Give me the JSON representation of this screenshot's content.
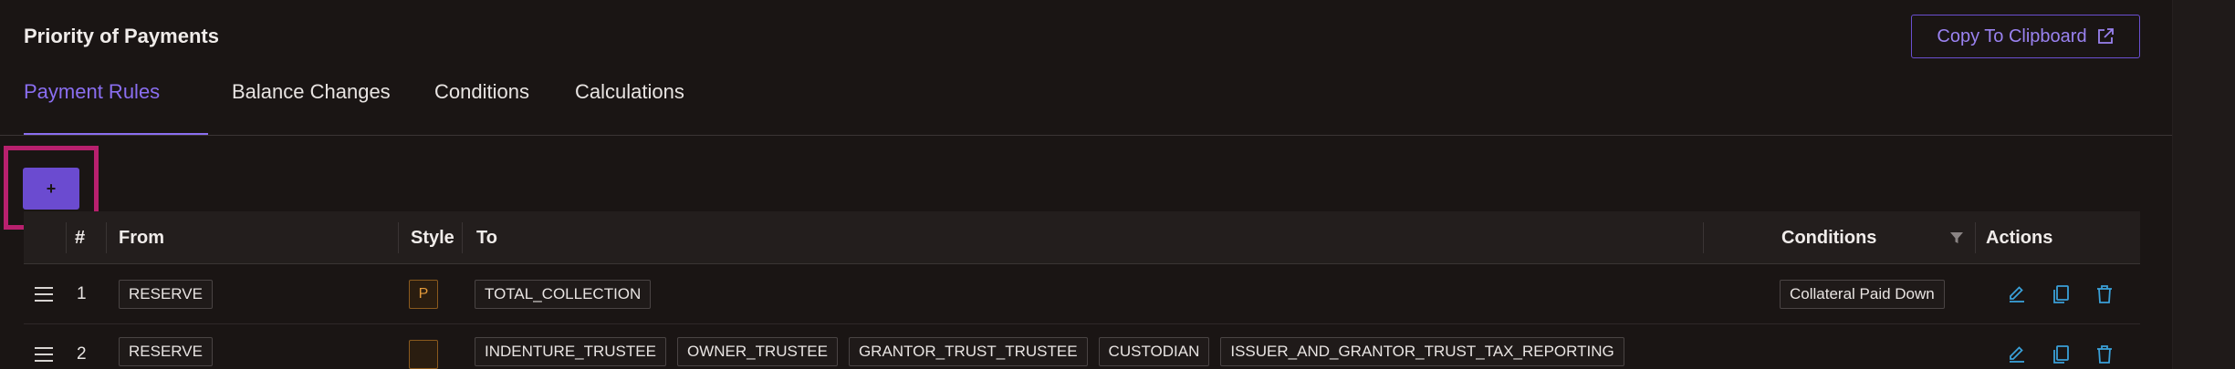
{
  "header": {
    "title": "Priority of Payments",
    "copy_button_label": "Copy To Clipboard"
  },
  "tabs": [
    {
      "label": "Payment Rules",
      "active": true
    },
    {
      "label": "Balance Changes",
      "active": false
    },
    {
      "label": "Conditions",
      "active": false
    },
    {
      "label": "Calculations",
      "active": false
    }
  ],
  "toolbar": {
    "add_label": "+"
  },
  "table": {
    "columns": {
      "index": "#",
      "from": "From",
      "style": "Style",
      "to": "To",
      "conditions": "Conditions",
      "actions": "Actions"
    },
    "rows": [
      {
        "index": "1",
        "from": "RESERVE",
        "style": "P",
        "to": [
          "TOTAL_COLLECTION"
        ],
        "condition": "Collateral Paid Down"
      },
      {
        "index": "2",
        "from": "RESERVE",
        "style": "",
        "to": [
          "INDENTURE_TRUSTEE",
          "OWNER_TRUSTEE",
          "GRANTOR_TRUST_TRUSTEE",
          "CUSTODIAN",
          "ISSUER_AND_GRANTOR_TRUST_TAX_REPORTING"
        ],
        "condition": ""
      }
    ]
  },
  "colors": {
    "accent": "#8a6ef0",
    "add_button": "#6b4bd0",
    "highlight": "#b8206e",
    "action_icons": "#3aa0d8",
    "style_tag": "#e39a3a"
  }
}
